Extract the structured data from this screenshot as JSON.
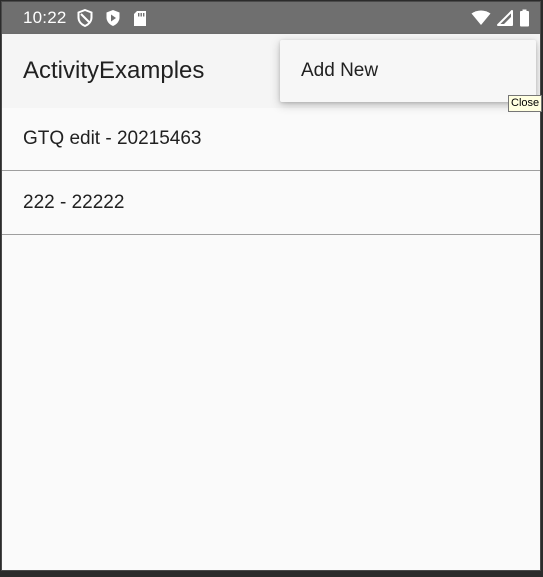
{
  "status_bar": {
    "time": "10:22",
    "left_icons": [
      "shield-outline-icon",
      "play-protect-icon",
      "sd-card-icon"
    ],
    "right_icons": [
      "wifi-icon",
      "signal-icon",
      "battery-icon"
    ]
  },
  "app_bar": {
    "title": "ActivityExamples"
  },
  "list": {
    "items": [
      {
        "label": "GTQ edit - 20215463"
      },
      {
        "label": "222 - 22222"
      }
    ]
  },
  "overflow_menu": {
    "items": [
      {
        "label": "Add New"
      }
    ]
  },
  "tooltip": {
    "text": "Close"
  },
  "colors": {
    "status_bar_bg": "#6f6f6f",
    "app_bar_bg": "#f5f5f5",
    "content_bg": "#fafafa",
    "divider": "#9e9e9e",
    "text_primary": "#212121",
    "tooltip_bg": "#ffffe1"
  }
}
